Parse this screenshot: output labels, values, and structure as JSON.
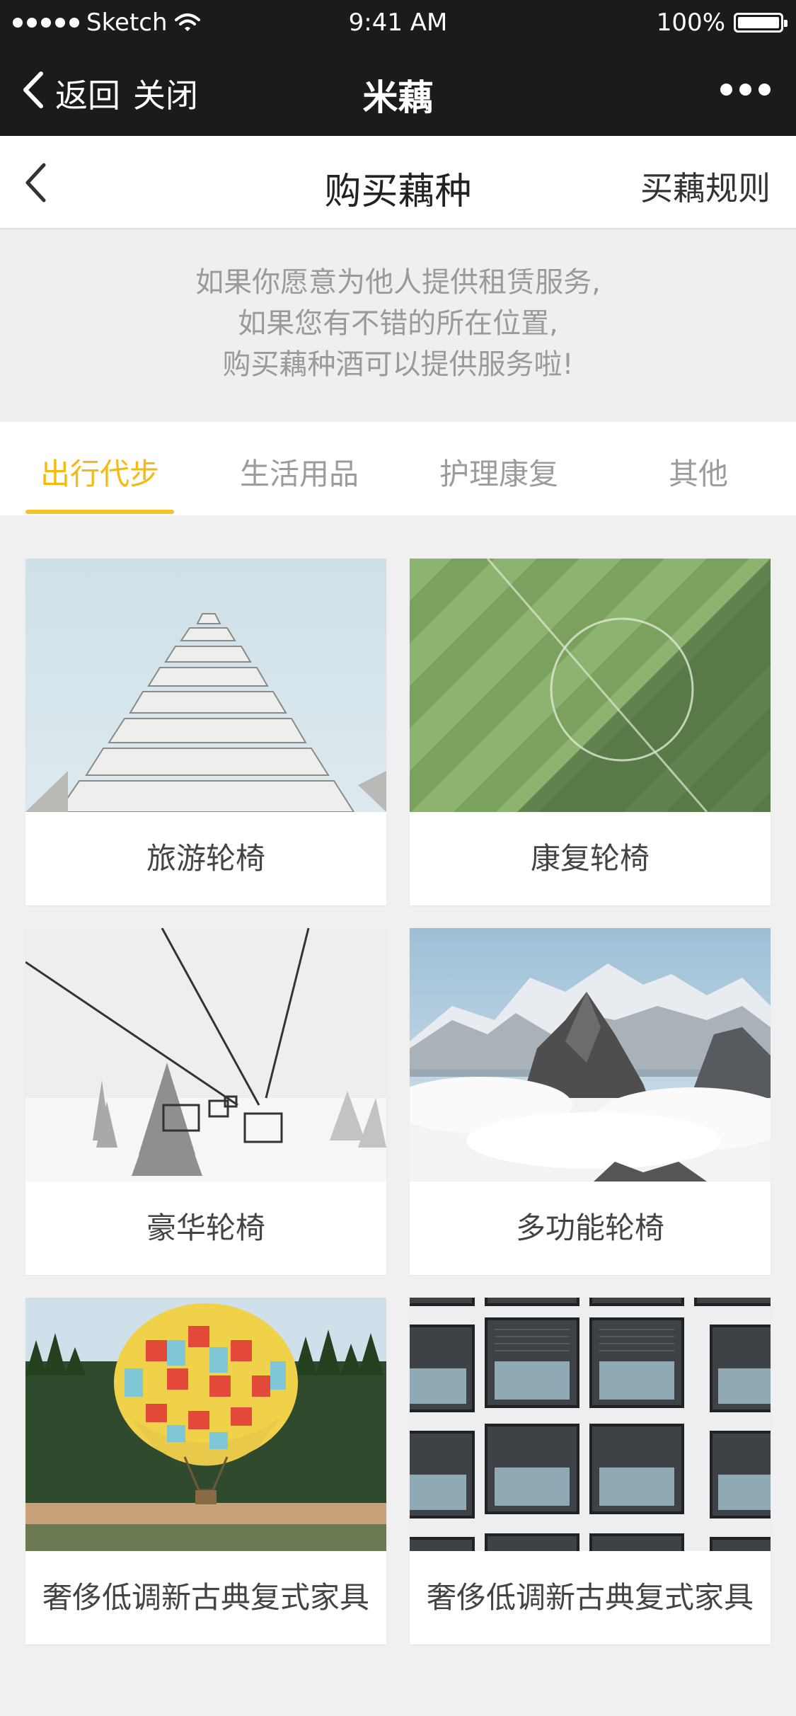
{
  "status_bar": {
    "carrier": "Sketch",
    "time": "9:41 AM",
    "battery": "100%"
  },
  "mini_nav": {
    "back_label": "返回",
    "close_label": "关闭",
    "title": "米藕"
  },
  "page_header": {
    "title": "购买藕种",
    "rules_link": "买藕规则"
  },
  "intro": {
    "line1": "如果你愿意为他人提供租赁服务,",
    "line2": "如果您有不错的所在位置,",
    "line3": "购买藕种酒可以提供服务啦!"
  },
  "tabs": [
    {
      "label": "出行代步",
      "active": true
    },
    {
      "label": "生活用品",
      "active": false
    },
    {
      "label": "护理康复",
      "active": false
    },
    {
      "label": "其他",
      "active": false
    }
  ],
  "products": [
    {
      "name": "旅游轮椅",
      "image": "building-pyramid"
    },
    {
      "name": "康复轮椅",
      "image": "striped-field"
    },
    {
      "name": "豪华轮椅",
      "image": "ski-lift"
    },
    {
      "name": "多功能轮椅",
      "image": "mountain-clouds"
    },
    {
      "name": "奢侈低调新古典复式家具",
      "image": "hot-air-balloon"
    },
    {
      "name": "奢侈低调新古典复式家具",
      "image": "building-windows"
    }
  ],
  "colors": {
    "accent": "#f6c22a",
    "accent_text": "#f6b90e",
    "nav_bg": "#1b1b1d",
    "page_bg": "#f0f0f0"
  }
}
